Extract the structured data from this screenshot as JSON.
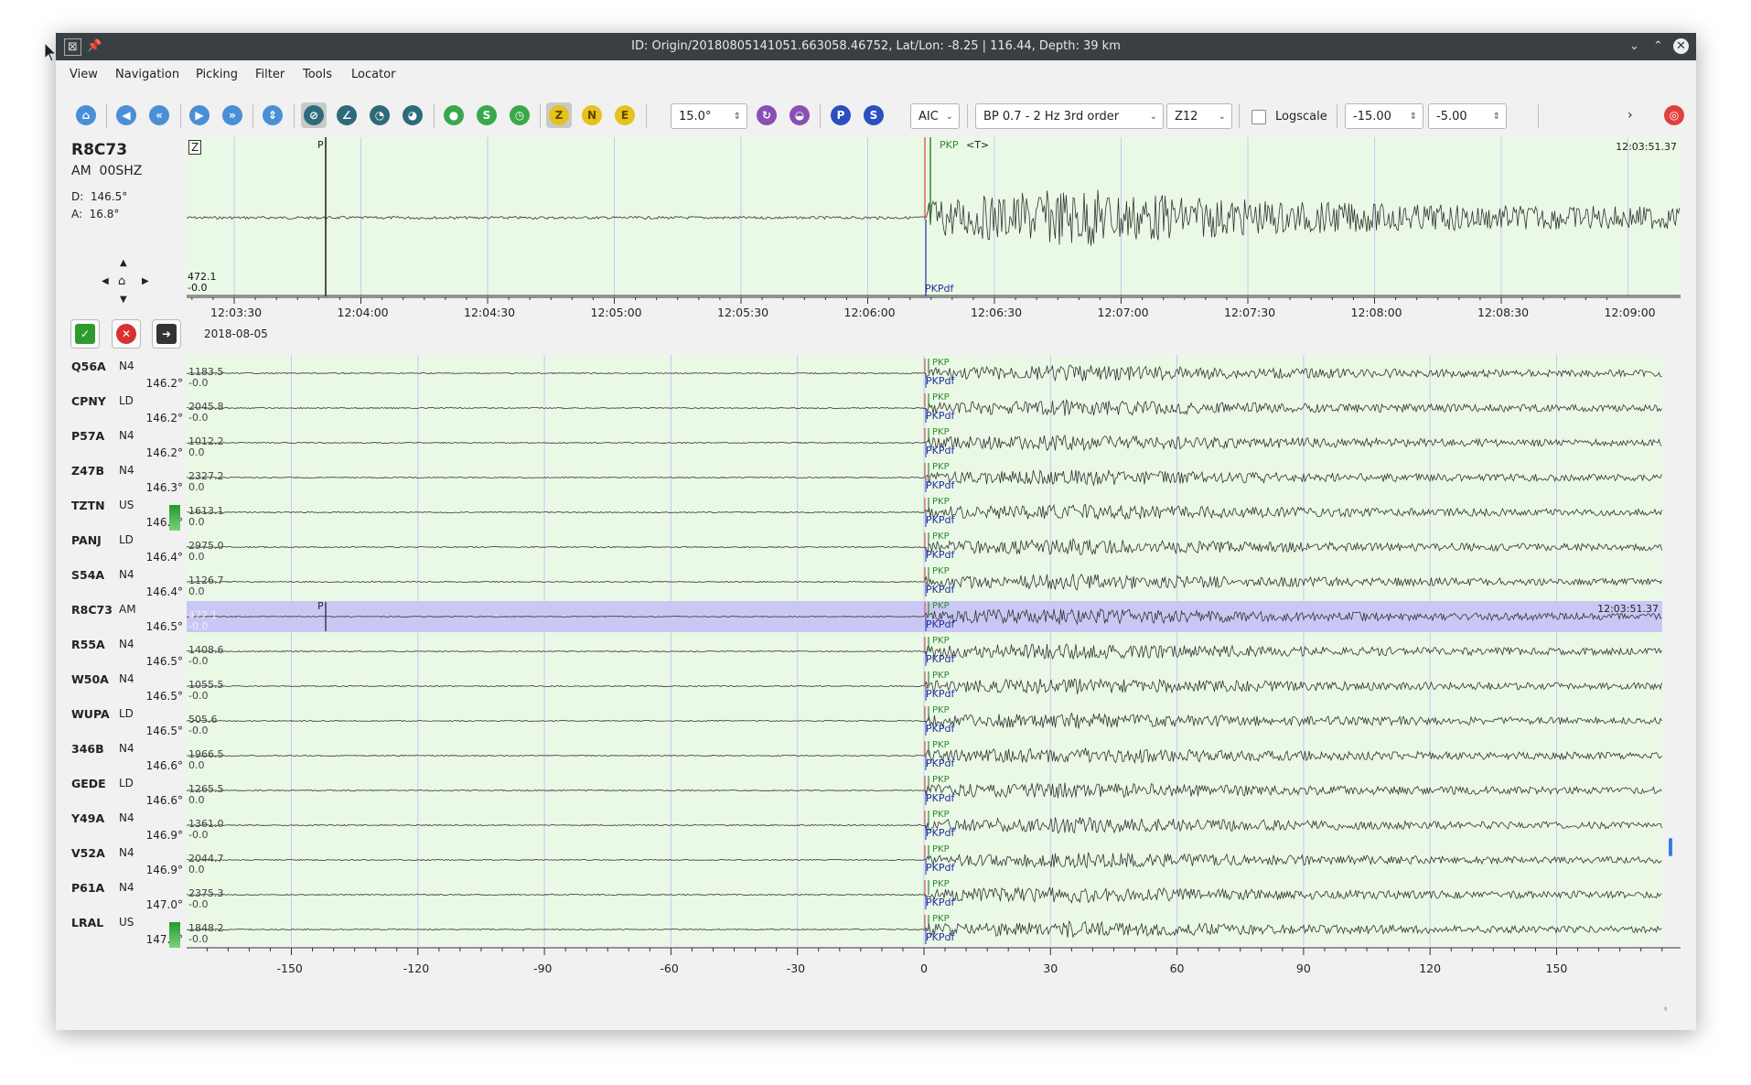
{
  "window": {
    "title": "ID: Origin/20180805141051.663058.46752, Lat/Lon: -8.25 | 116.44, Depth: 39 km"
  },
  "menu": [
    "View",
    "Navigation",
    "Picking",
    "Filter",
    "Tools",
    "Locator"
  ],
  "toolbar": {
    "zoom_value": "15.0°",
    "picker": "AIC",
    "filter": "BP 0.7 - 2 Hz  3rd order",
    "component": "Z12",
    "logscale_label": "Logscale",
    "logscale_checked": false,
    "min_value": "-15.00",
    "max_value": "-5.00",
    "phase_buttons": [
      "P",
      "S"
    ],
    "component_buttons": [
      "Z",
      "N",
      "E"
    ]
  },
  "main_trace": {
    "station": "R8C73",
    "stream": "AM  00SHZ",
    "distance": "D:  146.5°",
    "azimuth": "A:  16.8°",
    "component_label": "Z",
    "amp_max": "472.1",
    "amp_min": "-0.0",
    "time_label": "12:03:51.37",
    "picks": [
      "P",
      "PKP",
      "<T>",
      "PKPdf"
    ],
    "date": "2018-08-05",
    "time_ticks": [
      "12:03:30",
      "12:04:00",
      "12:04:30",
      "12:05:00",
      "12:05:30",
      "12:06:00",
      "12:06:30",
      "12:07:00",
      "12:07:30",
      "12:08:00",
      "12:08:30",
      "12:09:00"
    ]
  },
  "stations": [
    {
      "name": "Q56A",
      "net": "N4",
      "dist": "146.2°",
      "amp": "1183.5",
      "min": "-0.0"
    },
    {
      "name": "CPNY",
      "net": "LD",
      "dist": "146.2°",
      "amp": "2045.8",
      "min": "-0.0"
    },
    {
      "name": "P57A",
      "net": "N4",
      "dist": "146.2°",
      "amp": "1012.2",
      "min": "0.0"
    },
    {
      "name": "Z47B",
      "net": "N4",
      "dist": "146.3°",
      "amp": "2327.2",
      "min": "0.0"
    },
    {
      "name": "TZTN",
      "net": "US",
      "dist": "146.4°",
      "amp": "1613.1",
      "min": "0.0"
    },
    {
      "name": "PANJ",
      "net": "LD",
      "dist": "146.4°",
      "amp": "2975.0",
      "min": "0.0"
    },
    {
      "name": "S54A",
      "net": "N4",
      "dist": "146.4°",
      "amp": "1126.7",
      "min": "0.0"
    },
    {
      "name": "R8C73",
      "net": "AM",
      "dist": "146.5°",
      "amp": "472.1",
      "min": "-0.0",
      "selected": true
    },
    {
      "name": "R55A",
      "net": "N4",
      "dist": "146.5°",
      "amp": "1408.6",
      "min": "-0.0"
    },
    {
      "name": "W50A",
      "net": "N4",
      "dist": "146.5°",
      "amp": "1055.5",
      "min": "-0.0"
    },
    {
      "name": "WUPA",
      "net": "LD",
      "dist": "146.5°",
      "amp": "505.6",
      "min": "-0.0"
    },
    {
      "name": "346B",
      "net": "N4",
      "dist": "146.6°",
      "amp": "1966.5",
      "min": "0.0"
    },
    {
      "name": "GEDE",
      "net": "LD",
      "dist": "146.6°",
      "amp": "1265.5",
      "min": "0.0"
    },
    {
      "name": "Y49A",
      "net": "N4",
      "dist": "146.9°",
      "amp": "1361.0",
      "min": "-0.0"
    },
    {
      "name": "V52A",
      "net": "N4",
      "dist": "146.9°",
      "amp": "2044.7",
      "min": "0.0"
    },
    {
      "name": "P61A",
      "net": "N4",
      "dist": "147.0°",
      "amp": "2375.3",
      "min": "-0.0"
    },
    {
      "name": "LRAL",
      "net": "US",
      "dist": "147.1°",
      "amp": "1848.2",
      "min": "-0.0"
    }
  ],
  "list_pick_labels": [
    "PKP",
    "PKPdf"
  ],
  "selected_row_time": "12:03:51.37",
  "relative_axis_ticks": [
    "-150",
    "-120",
    "-90",
    "-60",
    "-30",
    "0",
    "30",
    "60",
    "90",
    "120",
    "150"
  ],
  "colors": {
    "trace_bg": "#eaf8e6",
    "selected_row": "#c9c8f5",
    "pick_p": "#1a1a1a",
    "pick_pkp": "#2e8b2e",
    "pick_pkpdf": "#1f2fa0",
    "marker_red": "#e23b3b",
    "titlebar": "#3a3f44"
  }
}
